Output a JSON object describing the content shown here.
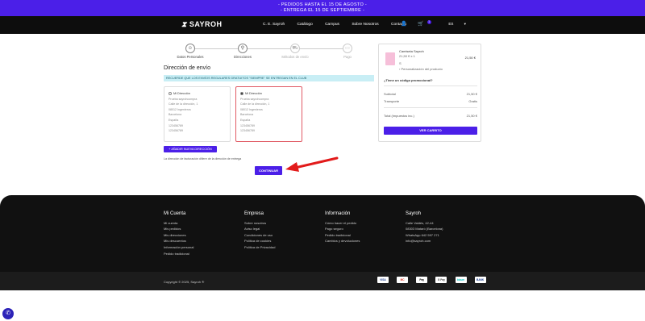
{
  "banner": {
    "line1": "- PEDIDOS HASTA EL 15 DE AGOSTO -",
    "line2": "- ENTREGA EL 15 DE SEPTIEMBRE -"
  },
  "header": {
    "logo": "SAYROH",
    "menu": [
      "C. E. Sayroh",
      "Catálogo",
      "Campus",
      "Sobre Nosotros",
      "Contacto"
    ],
    "cart_count": "1",
    "language": "ES"
  },
  "steps": [
    "Datos Personales",
    "Direcciones",
    "Métodos de envío",
    "Pago"
  ],
  "shipping": {
    "title": "Dirección de envío",
    "notice": "RECUERDE QUE LOS ENVÍOS REGULARES GRATUITOS \"SIEMPRE\" SE ENTREGAN EN EL CLUB",
    "addresses": [
      {
        "name": "Mi Dirección",
        "lines": [
          "Prueba sayrohcompra",
          "Calle de la dirección, 1",
          "08012 Ingenieros",
          "Barcelona",
          "España",
          "123456789",
          "123456789"
        ]
      },
      {
        "name": "Mi Dirección",
        "lines": [
          "Prueba sayrohcompra",
          "Calle de la dirección, 1",
          "08012 Ingenieros",
          "Barcelona",
          "España",
          "123456789",
          "123456789"
        ]
      }
    ],
    "add_button": "+ AÑADIR NUEVA DIRECCIÓN",
    "billing_note": "La dirección de facturación difiere de la dirección de entrega",
    "continue_button": "CONTINUAR"
  },
  "summary": {
    "product_name": "Camiseta Sayroh",
    "product_qty": "21,50 € x 1",
    "product_size": "S",
    "personalization": "Personalización del producto",
    "product_price": "21,50 €",
    "promo": "¿Tiene un código promocional?",
    "subtotal_label": "Subtotal",
    "subtotal": "21,50 €",
    "shipping_label": "Transporte",
    "shipping": "Gratis",
    "total_label": "Total (impuestos inc.)",
    "total": "21,50 €",
    "cart_button": "VER CARRITO"
  },
  "footer": {
    "columns": [
      {
        "title": "Mi Cuenta",
        "items": [
          "Mi cuenta",
          "Mis pedidos",
          "Mis direcciones",
          "Mis descuentos",
          "Información personal",
          "Pedido tradicional"
        ]
      },
      {
        "title": "Empresa",
        "items": [
          "Sobre nosotros",
          "Aviso legal",
          "Condiciones de uso",
          "Política de cookies",
          "Política de Privacidad"
        ]
      },
      {
        "title": "Información",
        "items": [
          "Cómo hacer el pedido",
          "Pago seguro",
          "Pedido tradicional",
          "Cambios y devoluciones"
        ]
      },
      {
        "title": "Sayroh",
        "items": [
          "Calle Valdés, 42-44",
          "08303 Mataró (Barcelona)",
          "WhatsApp 642 597 271",
          "info@sayroh.com"
        ]
      }
    ],
    "copyright": "Copyright © 2025, Sayroh ®",
    "payments": [
      "VISA",
      "MC",
      "Pay",
      "G Pay",
      "bizum",
      "BANK"
    ]
  }
}
